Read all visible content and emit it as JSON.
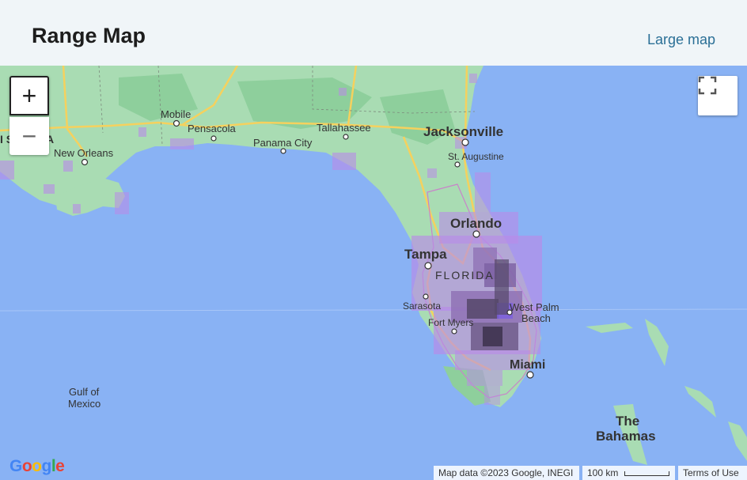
{
  "header": {
    "title": "Range Map",
    "large_map_link": "Large map"
  },
  "controls": {
    "zoom_in": "+",
    "zoom_out": "−",
    "fullscreen_icon": "fullscreen-icon"
  },
  "map": {
    "colors": {
      "water": "#89b2f4",
      "land": "#a9dcb3",
      "land_dark": "#8ecf9c",
      "road": "#f9d976",
      "range_light": "#b98ae8",
      "range_dark": "#3f3450"
    },
    "labels": {
      "mobile": "Mobile",
      "pensacola": "Pensacola",
      "tallahassee": "Tallahassee",
      "jacksonville": "Jacksonville",
      "new_orleans": "New Orleans",
      "panama_city": "Panama City",
      "st_augustine": "St. Augustine",
      "orlando": "Orlando",
      "tampa": "Tampa",
      "florida": "FLORIDA",
      "sarasota": "Sarasota",
      "fort_myers": "Fort Myers",
      "west_palm": "West Palm",
      "beach": "Beach",
      "miami": "Miami",
      "gulf1": "Gulf of",
      "gulf2": "Mexico",
      "bahamas1": "The",
      "bahamas2": "Bahamas",
      "cut_state": "I S",
      "cut_state2": "A"
    }
  },
  "footer": {
    "google_logo": [
      "G",
      "o",
      "o",
      "g",
      "l",
      "e"
    ],
    "logo_colors": [
      "#4285f4",
      "#ea4335",
      "#fbbc05",
      "#4285f4",
      "#34a853",
      "#ea4335"
    ],
    "map_data": "Map data ©2023 Google, INEGI",
    "scale": "100 km",
    "terms": "Terms of Use"
  }
}
